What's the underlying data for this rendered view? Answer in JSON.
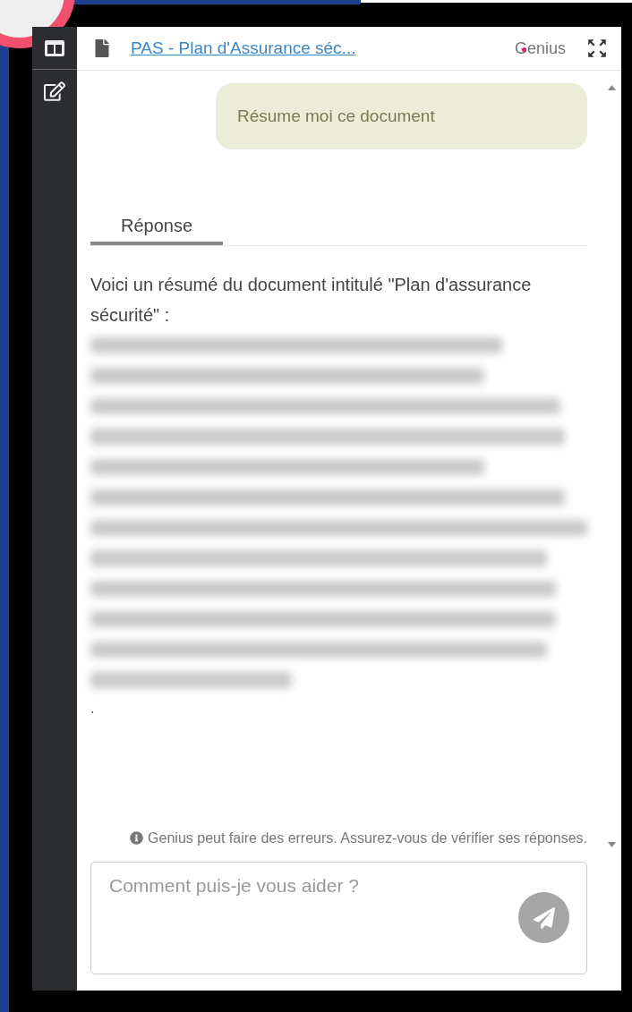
{
  "header": {
    "document_title": "PAS - Plan d'Assurance séc...",
    "logo": "Genius"
  },
  "user_message": "Résume moi ce document",
  "tabs": [
    {
      "label": "Réponse",
      "selected": true
    }
  ],
  "answer": {
    "intro": "Voici un résumé du document intitulé \"Plan d'assurance sécurité\" :",
    "trailing": "."
  },
  "disclaimer": "Genius peut faire des erreurs. Assurez-vous de vérifier ses réponses.",
  "composer": {
    "placeholder": "Comment puis-je vous aider ?"
  }
}
